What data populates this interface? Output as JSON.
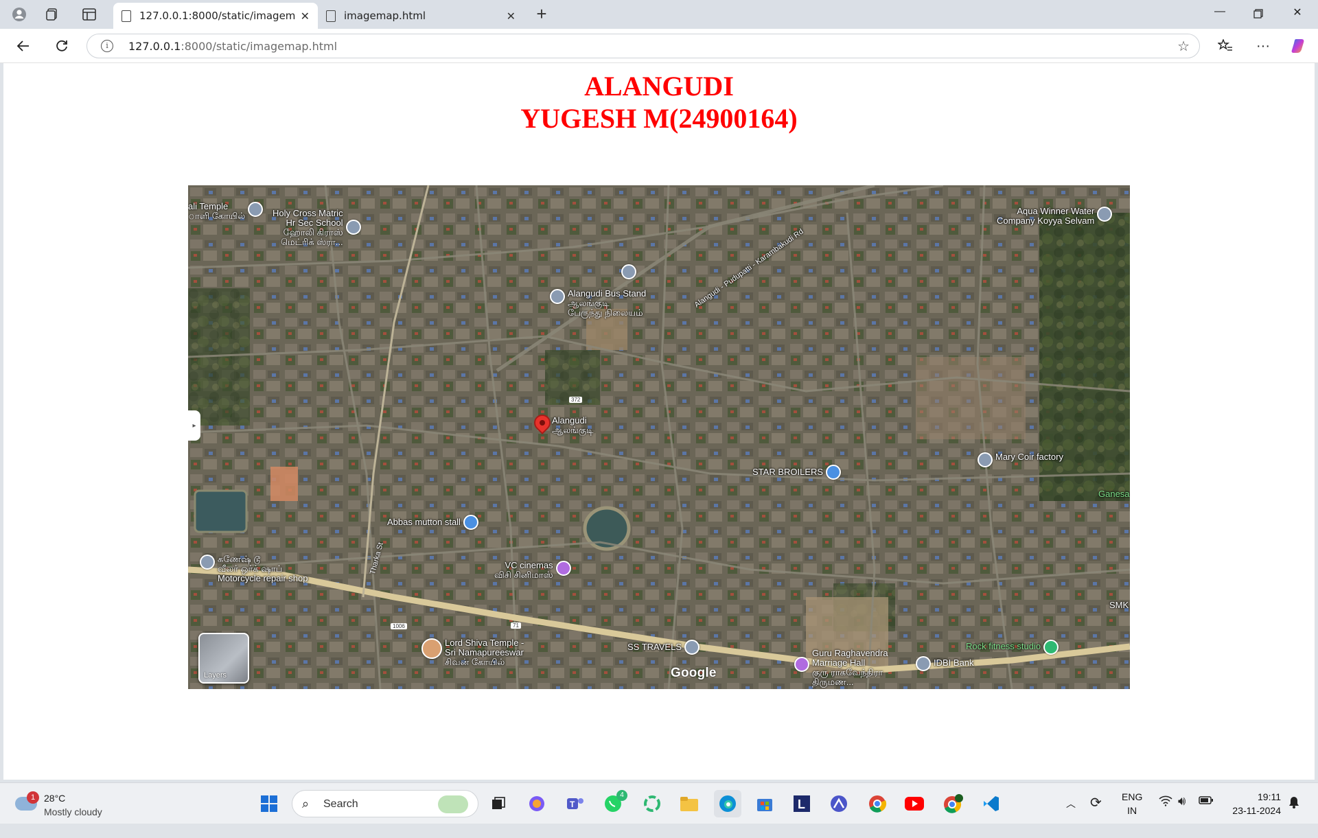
{
  "browser": {
    "tabs": [
      {
        "title": "127.0.0.1:8000/static/imagemap.h",
        "active": true
      },
      {
        "title": "imagemap.html",
        "active": false
      }
    ],
    "url_host": "127.0.0.1",
    "url_path": ":8000/static/imagemap.html"
  },
  "page": {
    "heading_line1": "ALANGUDI",
    "heading_line2": "YUGESH M(24900164)"
  },
  "map": {
    "pois": {
      "holy_cross": "Holy Cross Matric\nHr Sec School\nஹோலி கிராஸ்\nமெட்ரிக் ஸ்ரா...",
      "kali_temple": "ali Temple\nாளி கோயில்",
      "aqua_winner": "Aqua Winner Water\nCompany Koyya Selvam",
      "bus_stand": "Alangudi Bus Stand\nஆலங்குடி\nபேருந்து நிலையம்",
      "alangudi": "Alangudi\nஆலங்குடி",
      "mary_coir": "Mary Coir factory",
      "star_broilers": "STAR BROILERS",
      "ganesa": "Ganesa",
      "abbas": "Abbas mutton stall",
      "ganesh_motor": "கணேஷ் டூ\nவீலர் ஒர்க் ஷாப்\nMotorcycle repair shop",
      "vc_cinemas": "VC cinemas\nவிசி சினிமாஸ்",
      "smk": "SMK",
      "lord_shiva": "Lord Shiva Temple -\nSri Namapureeswar\nசிவன் கோயில்",
      "ss_travels": "SS TRAVELS",
      "guru": "Guru Raghavendra\nMarriage Hall\nகுரு ராகவேந்திரா\nதிருமண...",
      "idbi": "IDBI Bank",
      "rock_fitness": "Rock fitness studio",
      "road_label": "Alangudi - Pudupatti - Karambakudi Rd",
      "street_label": "Tharka St",
      "shield_372": "372",
      "shield_71": "71",
      "shield_1006": "1006"
    },
    "layers_label": "Layers",
    "google_label": "Google"
  },
  "taskbar": {
    "weather_badge": "1",
    "temperature": "28°C",
    "condition": "Mostly cloudy",
    "search_placeholder": "Search",
    "lang_line1": "ENG",
    "lang_line2": "IN",
    "time": "19:11",
    "date": "23-11-2024",
    "whatsapp_badge": "4"
  },
  "colors": {
    "heading": "#ff0000",
    "tab_bar": "#dadfe6",
    "taskbar": "#eef0f3"
  }
}
